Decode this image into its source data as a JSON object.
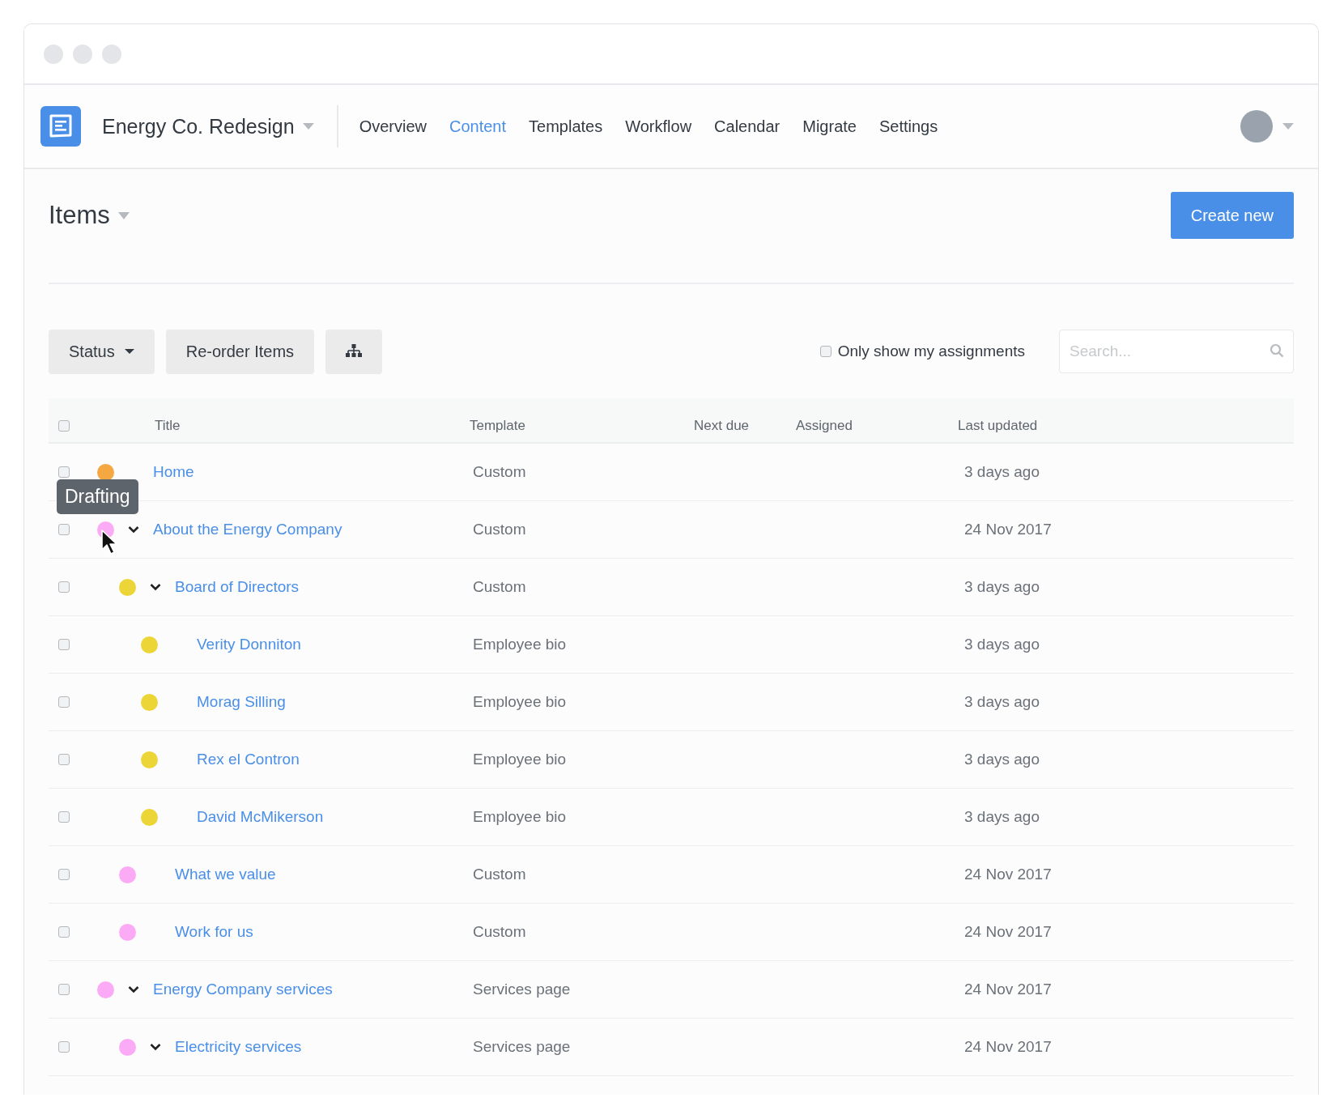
{
  "project": {
    "name": "Energy Co. Redesign"
  },
  "nav": [
    {
      "label": "Overview",
      "selected": false
    },
    {
      "label": "Content",
      "selected": true
    },
    {
      "label": "Templates",
      "selected": false
    },
    {
      "label": "Workflow",
      "selected": false
    },
    {
      "label": "Calendar",
      "selected": false
    },
    {
      "label": "Migrate",
      "selected": false
    },
    {
      "label": "Settings",
      "selected": false
    }
  ],
  "page": {
    "title": "Items",
    "create_button": "Create new"
  },
  "toolbar": {
    "status_button": "Status",
    "reorder_button": "Re-order Items",
    "only_mine": {
      "label": "Only show my assignments",
      "checked": false
    },
    "search": {
      "placeholder": "Search..."
    }
  },
  "table": {
    "select_all_checked": false,
    "columns": [
      "Title",
      "Template",
      "Next due",
      "Assigned",
      "Last updated"
    ],
    "rows": [
      {
        "title": "Home",
        "template": "Custom",
        "last_updated": "3 days ago",
        "color": "#f5a742",
        "checked": false,
        "tooltip": "Drafting"
      },
      {
        "title": "About the Energy Company",
        "template": "Custom",
        "last_updated": "24 Nov 2017",
        "color": "#fbaaf5",
        "checked": false,
        "expanded": true,
        "children": [
          {
            "title": "Board of Directors",
            "template": "Custom",
            "last_updated": "3 days ago",
            "color": "#ecd537",
            "checked": false,
            "expanded": true,
            "children": [
              {
                "title": "Verity Donniton",
                "template": "Employee bio",
                "last_updated": "3 days ago",
                "color": "#ecd537",
                "checked": false
              },
              {
                "title": "Morag Silling",
                "template": "Employee bio",
                "last_updated": "3 days ago",
                "color": "#ecd537",
                "checked": false
              },
              {
                "title": "Rex el Contron",
                "template": "Employee bio",
                "last_updated": "3 days ago",
                "color": "#ecd537",
                "checked": false
              },
              {
                "title": "David McMikerson",
                "template": "Employee bio",
                "last_updated": "3 days ago",
                "color": "#ecd537",
                "checked": false
              }
            ]
          },
          {
            "title": "What we value",
            "template": "Custom",
            "last_updated": "24 Nov 2017",
            "color": "#fbaaf5",
            "checked": false
          },
          {
            "title": "Work for us",
            "template": "Custom",
            "last_updated": "24 Nov 2017",
            "color": "#fbaaf5",
            "checked": false
          }
        ]
      },
      {
        "title": "Energy Company services",
        "template": "Services page",
        "last_updated": "24 Nov 2017",
        "color": "#fbaaf5",
        "checked": false,
        "expanded": true,
        "children": [
          {
            "title": "Electricity services",
            "template": "Services page",
            "last_updated": "24 Nov 2017",
            "color": "#fbaaf5",
            "checked": false,
            "expanded": true
          }
        ]
      }
    ]
  }
}
